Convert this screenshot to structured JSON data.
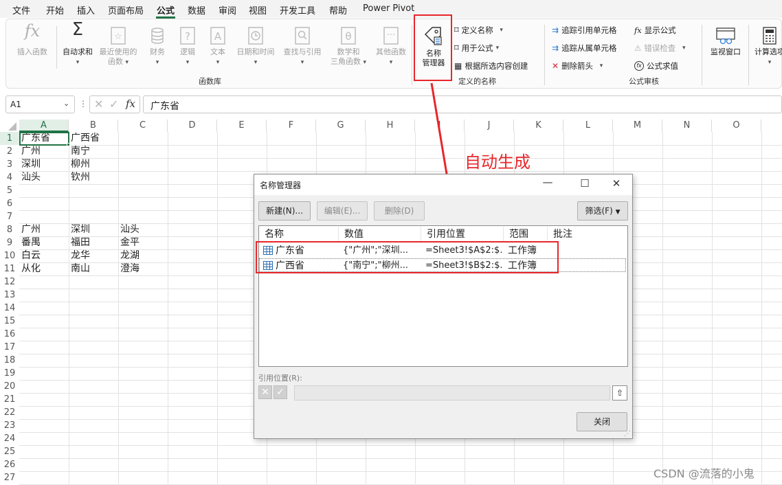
{
  "menu": {
    "items": [
      "文件",
      "开始",
      "插入",
      "页面布局",
      "公式",
      "数据",
      "审阅",
      "视图",
      "开发工具",
      "帮助",
      "Power Pivot"
    ],
    "active": "公式"
  },
  "ribbon": {
    "function_library": {
      "insert_function": "插入函数",
      "autosum": "自动求和",
      "recent_1": "最近使用的",
      "recent_2": "函数",
      "financial": "财务",
      "logical": "逻辑",
      "text": "文本",
      "datetime": "日期和时间",
      "lookup": "查找与引用",
      "math_1": "数学和",
      "math_2": "三角函数",
      "more": "其他函数",
      "group_label": "函数库"
    },
    "defined_names": {
      "name_manager_1": "名称",
      "name_manager_2": "管理器",
      "define_name": "定义名称",
      "use_in_formula": "用于公式",
      "create_from_selection": "根据所选内容创建",
      "group_label": "定义的名称"
    },
    "formula_auditing": {
      "trace_precedents": "追踪引用单元格",
      "trace_dependents": "追踪从属单元格",
      "remove_arrows": "删除箭头",
      "show_formulas": "显示公式",
      "error_checking": "错误检查",
      "evaluate_formula": "公式求值",
      "group_label": "公式审核"
    },
    "watch_window": "监视窗口",
    "calc_options": "计算选项"
  },
  "formula_bar": {
    "name_box": "A1",
    "fx": "fx",
    "content": "广东省"
  },
  "sheet": {
    "columns": [
      "A",
      "B",
      "C",
      "D",
      "E",
      "F",
      "G",
      "H",
      "I",
      "J",
      "K",
      "L",
      "M",
      "N",
      "O"
    ],
    "rows": [
      "1",
      "2",
      "3",
      "4",
      "5",
      "6",
      "7",
      "8",
      "9",
      "10",
      "11",
      "12",
      "13",
      "14",
      "15",
      "16",
      "17",
      "18",
      "19",
      "20",
      "21",
      "22",
      "23",
      "24",
      "25",
      "26",
      "27"
    ],
    "cells": {
      "A1": "广东省",
      "B1": "广西省",
      "A2": "广州",
      "B2": "南宁",
      "A3": "深圳",
      "B3": "柳州",
      "A4": "汕头",
      "B4": "钦州",
      "A8": "广州",
      "B8": "深圳",
      "C8": "汕头",
      "A9": "番禺",
      "B9": "福田",
      "C9": "金平",
      "A10": "白云",
      "B10": "龙华",
      "C10": "龙湖",
      "A11": "从化",
      "B11": "南山",
      "C11": "澄海"
    }
  },
  "dialog": {
    "title": "名称管理器",
    "btn_new": "新建(N)...",
    "btn_edit": "编辑(E)...",
    "btn_delete": "删除(D)",
    "btn_filter": "筛选(F)",
    "columns": [
      "名称",
      "数值",
      "引用位置",
      "范围",
      "批注"
    ],
    "rows": [
      {
        "name": "广东省",
        "value": "{\"广州\";\"深圳...",
        "refers": "=Sheet3!$A$2:$...",
        "scope": "工作簿",
        "comment": ""
      },
      {
        "name": "广西省",
        "value": "{\"南宁\";\"柳州...",
        "refers": "=Sheet3!$B$2:$...",
        "scope": "工作簿",
        "comment": ""
      }
    ],
    "ref_label": "引用位置(R):",
    "btn_close": "关闭"
  },
  "annotation": {
    "text": "自动生成",
    "color": "#e8262a"
  },
  "watermark": "CSDN @流落的小鬼",
  "colors": {
    "excel_green": "#217346",
    "annotation_red": "#e8262a"
  }
}
